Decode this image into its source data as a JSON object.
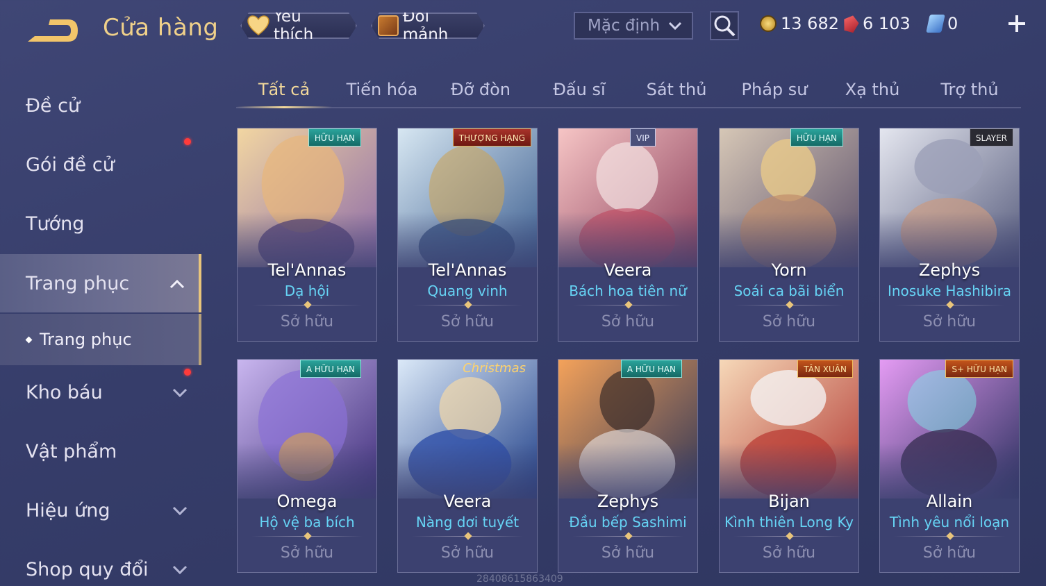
{
  "header": {
    "title": "Cửa hàng",
    "favorites_label": "Yêu thích",
    "shard_exchange_label": "Đổi mảnh",
    "sort_value": "Mặc định",
    "currencies": [
      {
        "name": "gold-coin-icon",
        "value": "13 682"
      },
      {
        "name": "ruby-gem-icon",
        "value": "6 103"
      },
      {
        "name": "voucher-icon",
        "value": "0"
      }
    ]
  },
  "sidebar": {
    "items": [
      {
        "label": "Đề cử"
      },
      {
        "label": "Gói đề cử"
      },
      {
        "label": "Tướng"
      },
      {
        "label": "Trang phục"
      },
      {
        "label": "Trang phục"
      },
      {
        "label": "Kho báu"
      },
      {
        "label": "Vật phẩm"
      },
      {
        "label": "Hiệu ứng"
      },
      {
        "label": "Shop quy đổi"
      }
    ]
  },
  "tabs": [
    "Tất cả",
    "Tiến hóa",
    "Đỡ đòn",
    "Đấu sĩ",
    "Sát thủ",
    "Pháp sư",
    "Xạ thủ",
    "Trợ thủ"
  ],
  "cards": [
    {
      "hero": "Tel'Annas",
      "skin": "Dạ hội",
      "status": "Sở hữu",
      "badge": "HỮU HẠN"
    },
    {
      "hero": "Tel'Annas",
      "skin": "Quang vinh",
      "status": "Sở hữu",
      "badge": "THƯỢNG HẠNG"
    },
    {
      "hero": "Veera",
      "skin": "Bách hoa tiên nữ",
      "status": "Sở hữu",
      "badge": "VIP"
    },
    {
      "hero": "Yorn",
      "skin": "Soái ca bãi biển",
      "status": "Sở hữu",
      "badge": "HỮU HẠN"
    },
    {
      "hero": "Zephys",
      "skin": "Inosuke Hashibira",
      "status": "Sở hữu",
      "badge": "SLAYER"
    },
    {
      "hero": "Omega",
      "skin": "Hộ vệ ba bích",
      "status": "Sở hữu",
      "badge": "A HỮU HẠN"
    },
    {
      "hero": "Veera",
      "skin": "Nàng dơi tuyết",
      "status": "Sở hữu",
      "badge": "Christmas"
    },
    {
      "hero": "Zephys",
      "skin": "Đầu bếp Sashimi",
      "status": "Sở hữu",
      "badge": "A HỮU HẠN"
    },
    {
      "hero": "Bijan",
      "skin": "Kình thiên Long Ky",
      "status": "Sở hữu",
      "badge": "TÂN XUÂN"
    },
    {
      "hero": "Allain",
      "skin": "Tình yêu nổi loạn",
      "status": "Sở hữu",
      "badge": "S+ HỮU HẠN"
    }
  ],
  "watermark": "284086158634​09",
  "colors": {
    "accent_gold": "#f3d99b",
    "skin_name": "#66d4f5",
    "notification": "#ff3b3b"
  }
}
